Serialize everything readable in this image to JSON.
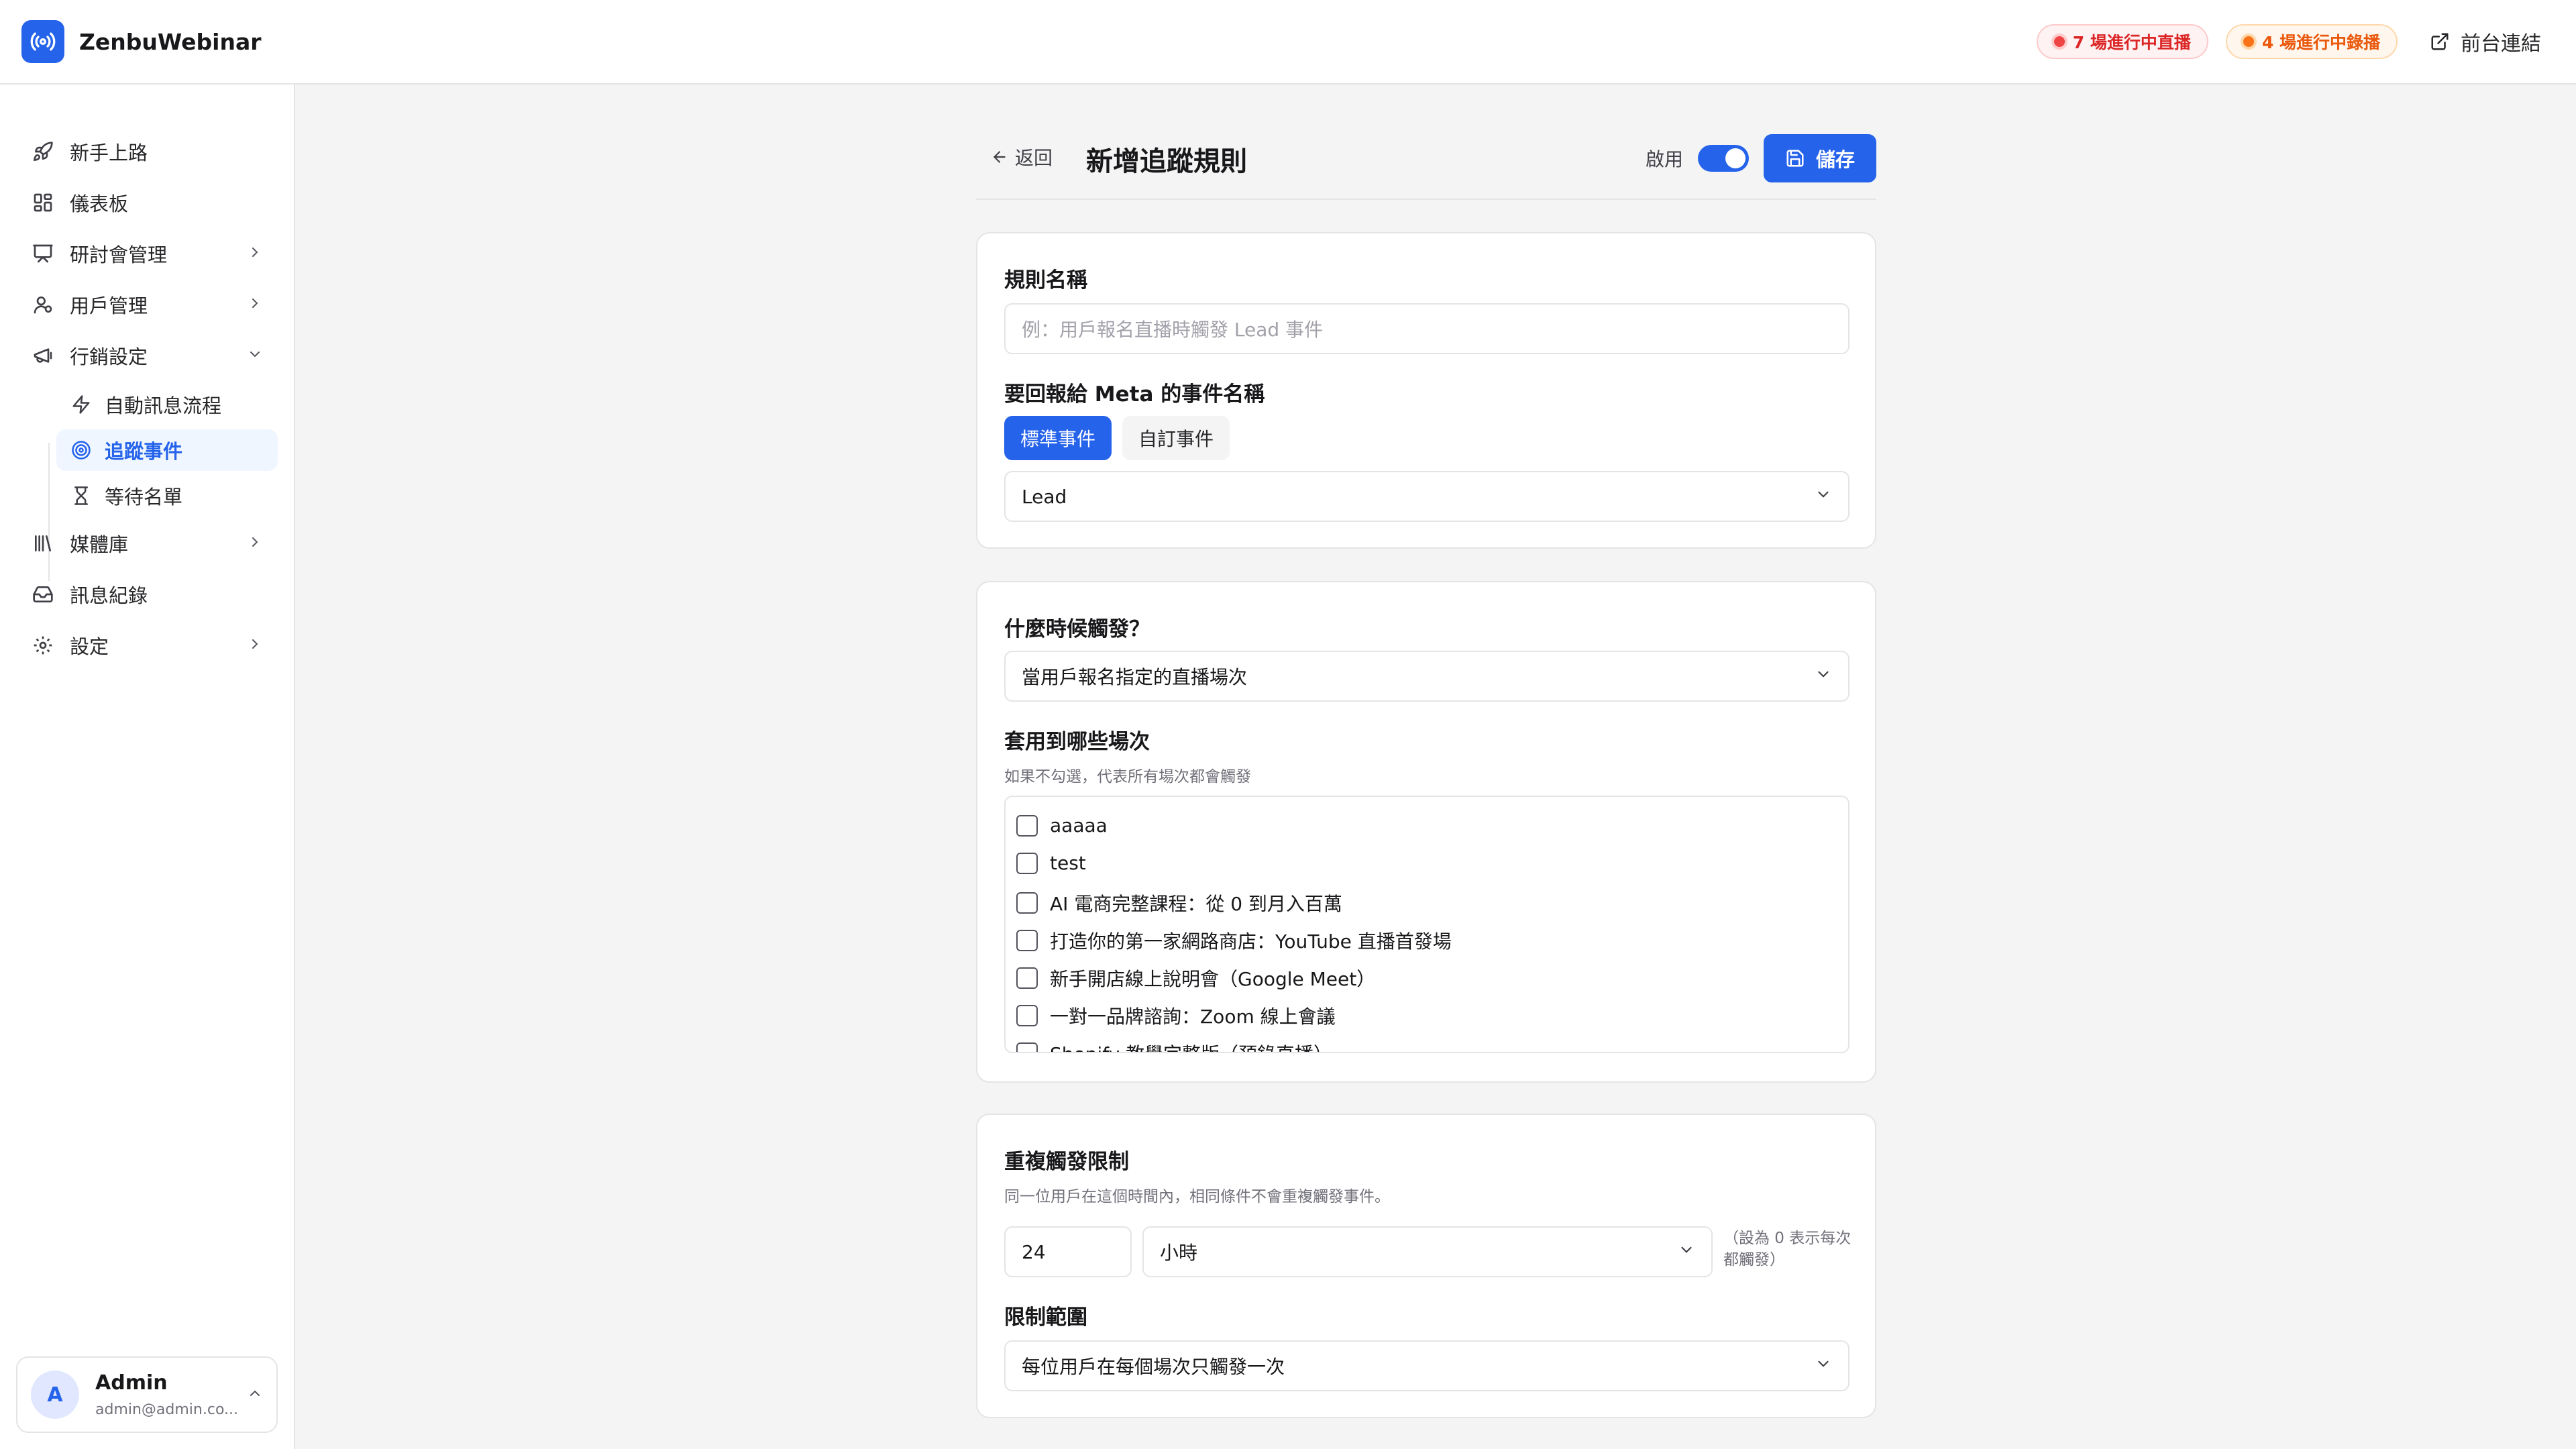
{
  "app": {
    "name": "ZenbuWebinar",
    "logo_icon": "broadcast-icon",
    "accent": "#2563eb"
  },
  "header": {
    "live_badge": "7 場進行中直播",
    "recording_badge": "4 場進行中錄播",
    "front_link": "前台連結"
  },
  "sidebar": {
    "items": [
      {
        "label": "新手上路",
        "icon": "rocket-icon"
      },
      {
        "label": "儀表板",
        "icon": "dashboard-icon"
      },
      {
        "label": "研討會管理",
        "icon": "presentation-icon"
      },
      {
        "label": "用戶管理",
        "icon": "users-icon"
      },
      {
        "label": "行銷設定",
        "icon": "megaphone-icon"
      },
      {
        "label": "媒體庫",
        "icon": "library-icon"
      },
      {
        "label": "訊息紀錄",
        "icon": "inbox-icon"
      },
      {
        "label": "設定",
        "icon": "gear-icon"
      }
    ],
    "sub_items": [
      {
        "label": "自動訊息流程",
        "icon": "zap-icon"
      },
      {
        "label": "追蹤事件",
        "icon": "target-icon"
      },
      {
        "label": "等待名單",
        "icon": "hourglass-icon"
      }
    ]
  },
  "user": {
    "initial": "A",
    "name": "Admin",
    "email": "admin@admin.co..."
  },
  "page": {
    "back": "返回",
    "title": "新增追蹤規則",
    "enable_label": "啟用",
    "enabled": true,
    "save": "儲存"
  },
  "rule": {
    "name_label": "規則名稱",
    "name_placeholder": "例：用戶報名直播時觸發 Lead 事件",
    "event_label": "要回報給 Meta 的事件名稱",
    "tab_standard": "標準事件",
    "tab_custom": "自訂事件",
    "event_value": "Lead"
  },
  "trigger": {
    "when_label": "什麼時候觸發？",
    "when_value": "當用戶報名指定的直播場次",
    "apply_label": "套用到哪些場次",
    "apply_help": "如果不勾選，代表所有場次都會觸發",
    "sessions": [
      "aaaaa",
      "test",
      "AI 電商完整課程：從 0 到月入百萬",
      "打造你的第一家網路商店：YouTube 直播首發場",
      "新手開店線上說明會（Google Meet）",
      "一對一品牌諮詢：Zoom 線上會議",
      "Shopify 教學完整版（預錄直播）"
    ]
  },
  "limit": {
    "label": "重複觸發限制",
    "help": "同一位用戶在這個時間內，相同條件不會重複觸發事件。",
    "amount": "24",
    "unit": "小時",
    "note": "（設為 0 表示每次都觸發）",
    "scope_label": "限制範圍",
    "scope_value": "每位用戶在每個場次只觸發一次"
  }
}
